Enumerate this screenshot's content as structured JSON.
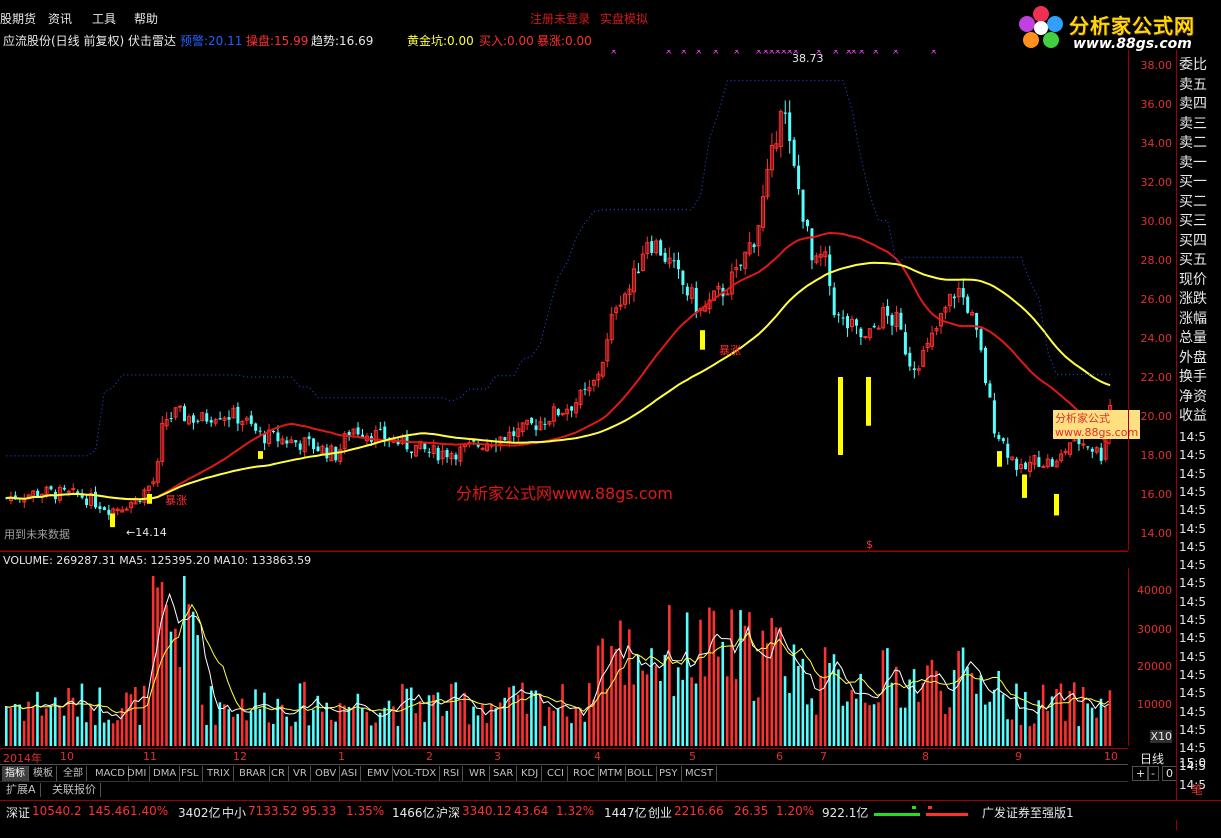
{
  "menu": {
    "items": [
      "股期货",
      "资讯",
      "工具",
      "帮助"
    ],
    "center_links": [
      "注册未登录",
      "实盘模拟"
    ]
  },
  "logo": {
    "text": "分析家公式网",
    "url": "www.88gs.com"
  },
  "info": {
    "stock_name": "应流股份(日线 前复权) 伏击雷达",
    "items": [
      {
        "label": "预警:",
        "value": "20.11",
        "color": "#2060ff"
      },
      {
        "label": "操盘:",
        "value": "15.99",
        "color": "#ff3030"
      },
      {
        "label": "趋势:",
        "value": "16.69",
        "color": "#e8e8e8"
      },
      {
        "label": "黄金坑:",
        "value": "0.00",
        "color": "#ffff40"
      },
      {
        "label": "买入:",
        "value": "0.00",
        "color": "#ff3030"
      },
      {
        "label": "暴涨:",
        "value": "0.00",
        "color": "#ff3030"
      }
    ]
  },
  "chart": {
    "high_label": "38.73",
    "low_label": "14.14",
    "future_data_note": "用到未来数据",
    "watermark": "分析家公式网www.88gs.com",
    "burst_label": "暴涨",
    "dollar_mark": "$",
    "price_ticks": [
      "38.00",
      "36.00",
      "34.00",
      "32.00",
      "30.00",
      "28.00",
      "26.00",
      "24.00",
      "22.00",
      "20.00",
      "18.00",
      "16.00",
      "14.00"
    ],
    "volume_ticks": [
      "40000",
      "30000",
      "20000",
      "10000"
    ],
    "volume_unit": "X10"
  },
  "volume": {
    "title": "VOLUME: 269287.31  MA5: 125395.20  MA10: 133863.59"
  },
  "dates": {
    "year": "2014年",
    "months": [
      "10",
      "11",
      "12",
      "1",
      "2",
      "3",
      "4",
      "5",
      "6",
      "7",
      "8",
      "9",
      "10"
    ]
  },
  "right_panel": {
    "labels": [
      "委比",
      "卖五",
      "卖四",
      "卖三",
      "卖二",
      "卖一",
      "买一",
      "买二",
      "买三",
      "买四",
      "买五",
      "现价",
      "涨跌",
      "涨幅",
      "总量",
      "外盘",
      "换手",
      "净资",
      "收益"
    ],
    "times": [
      "14:5",
      "14:5",
      "14:5",
      "14:5",
      "14:5",
      "14:5",
      "14:5",
      "14:5",
      "14:5",
      "14:5",
      "14:5",
      "14:5",
      "14:5",
      "14:5",
      "14:5",
      "14:5",
      "14:5",
      "14:5",
      "14:5",
      "14:5"
    ],
    "last_time": "15:0",
    "period": "日线",
    "controls": [
      "+",
      "-",
      "0"
    ],
    "pen": "笔",
    "ad_label": "分析家公式www.88gs.com"
  },
  "indicator_tabs": [
    "指标",
    "模板",
    "全部",
    "MACD",
    "DMI",
    "DMA",
    "FSL",
    "TRIX",
    "BRAR",
    "CR",
    "VR",
    "OBV",
    "ASI",
    "EMV",
    "VOL-TDX",
    "RSI",
    "WR",
    "SAR",
    "KDJ",
    "CCI",
    "ROC",
    "MTM",
    "BOLL",
    "PSY",
    "MCST"
  ],
  "sub_tabs": [
    "扩展A",
    "关联报价"
  ],
  "status": {
    "indices": [
      {
        "name": "深证",
        "value": "10540.2",
        "change": "145.46",
        "pct": "1.40%",
        "amount": "3402亿"
      },
      {
        "name": "中小",
        "value": "7133.52",
        "change": "95.33",
        "pct": "1.35%",
        "amount": "1466亿"
      },
      {
        "name": "沪深",
        "value": "3340.12",
        "change": "43.64",
        "pct": "1.32%",
        "amount": "1447亿"
      },
      {
        "name": "创业",
        "value": "2216.66",
        "change": "26.35",
        "pct": "1.20%",
        "amount": "922.1亿"
      }
    ],
    "broker": "广发证券至强版1"
  },
  "colors": {
    "up": "#ff3030",
    "down": "#54ffff",
    "ma_red": "#e01818",
    "ma_yellow": "#ffff40",
    "axis": "#9a0000"
  }
}
